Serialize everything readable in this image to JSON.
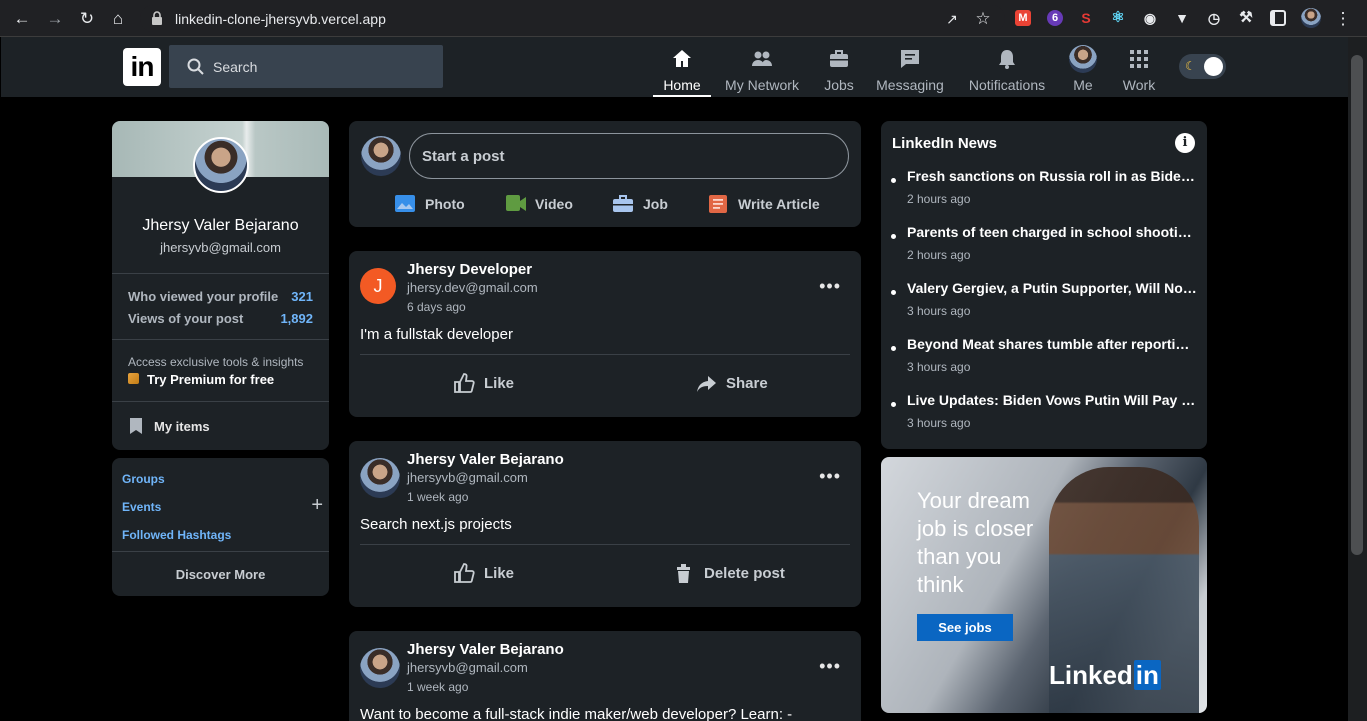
{
  "browser": {
    "url": "linkedin-clone-jhersyvb.vercel.app",
    "ext_badge": "6",
    "ext_s": "S"
  },
  "nav": {
    "logo": "in",
    "search_placeholder": "Search",
    "items": [
      {
        "label": "Home",
        "icon": "home-icon",
        "active": true
      },
      {
        "label": "My Network",
        "icon": "network-icon"
      },
      {
        "label": "Jobs",
        "icon": "briefcase-icon"
      },
      {
        "label": "Messaging",
        "icon": "message-icon"
      },
      {
        "label": "Notifications",
        "icon": "bell-icon"
      },
      {
        "label": "Me",
        "icon": "avatar"
      },
      {
        "label": "Work",
        "icon": "grid-icon"
      }
    ]
  },
  "profile": {
    "name": "Jhersy Valer Bejarano",
    "email": "jhersyvb@gmail.com",
    "stats": [
      {
        "label": "Who viewed your profile",
        "value": "321"
      },
      {
        "label": "Views of your post",
        "value": "1,892"
      }
    ],
    "premium_caption": "Access exclusive tools & insights",
    "premium_link": "Try Premium for free",
    "my_items": "My items"
  },
  "left_links": {
    "groups": "Groups",
    "events": "Events",
    "hashtags": "Followed Hashtags",
    "discover": "Discover More"
  },
  "post_box": {
    "placeholder": "Start a post",
    "photo": "Photo",
    "video": "Video",
    "job": "Job",
    "article": "Write Article",
    "colors": {
      "photo": "#378fe9",
      "video": "#5f9b41",
      "job": "#a8c5ed",
      "article": "#e16745"
    }
  },
  "posts": [
    {
      "initial": "J",
      "name": "Jhersy Developer",
      "email": "jhersy.dev@gmail.com",
      "time": "6 days ago",
      "text": "I'm a fullstak developer",
      "action1": "Like",
      "action2": "Share"
    },
    {
      "name": "Jhersy Valer Bejarano",
      "email": "jhersyvb@gmail.com",
      "time": "1 week ago",
      "text": "Search next.js projects",
      "action1": "Like",
      "action2": "Delete post"
    },
    {
      "name": "Jhersy Valer Bejarano",
      "email": "jhersyvb@gmail.com",
      "time": "1 week ago",
      "text": "Want to become a full-stack indie maker/web developer? Learn: -"
    }
  ],
  "news": {
    "title": "LinkedIn News",
    "items": [
      {
        "headline": "Fresh sanctions on Russia roll in as Biden …",
        "time": "2 hours ago"
      },
      {
        "headline": "Parents of teen charged in school shootin…",
        "time": "2 hours ago"
      },
      {
        "headline": "Valery Gergiev, a Putin Supporter, Will No…",
        "time": "3 hours ago"
      },
      {
        "headline": "Beyond Meat shares tumble after reportin…",
        "time": "3 hours ago"
      },
      {
        "headline": "Live Updates: Biden Vows Putin Will Pay f…",
        "time": "3 hours ago"
      }
    ]
  },
  "ad": {
    "headline": "Your dream job is closer than you think",
    "button": "See jobs",
    "brand": "Linked",
    "brand_in": "in"
  }
}
